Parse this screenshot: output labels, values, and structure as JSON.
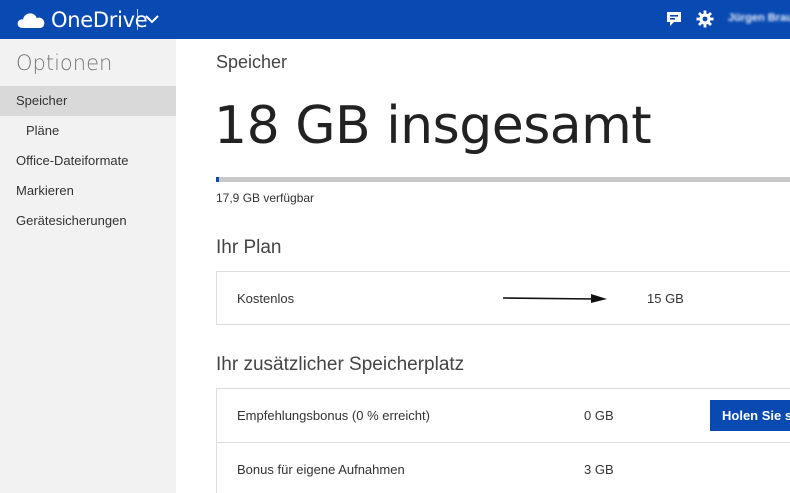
{
  "header": {
    "app_name": "OneDrive",
    "user_name": "Jürgen Braun",
    "brand_color": "#094ab2",
    "icons": [
      "cloud-logo-icon",
      "chevron-down-icon",
      "feedback-icon",
      "gear-icon"
    ]
  },
  "sidebar": {
    "title": "Optionen",
    "items": [
      {
        "label": "Speicher",
        "active": true
      },
      {
        "label": "Pläne",
        "active": false
      },
      {
        "label": "Office-Dateiformate",
        "active": false
      },
      {
        "label": "Markieren",
        "active": false
      },
      {
        "label": "Gerätesicherungen",
        "active": false
      }
    ]
  },
  "main": {
    "title": "Speicher",
    "total": "18 GB insgesamt",
    "usage_fraction": 0.005,
    "available": "17,9 GB verfügbar",
    "plan_section": {
      "title": "Ihr Plan",
      "plan_name": "Kostenlos",
      "plan_size": "15 GB"
    },
    "extra_section": {
      "title": "Ihr zusätzlicher Speicherplatz",
      "rows": [
        {
          "label": "Empfehlungsbonus (0 % erreicht)",
          "value": "0 GB",
          "button": "Holen Sie s"
        },
        {
          "label": "Bonus für eigene Aufnahmen",
          "value": "3 GB"
        }
      ]
    }
  }
}
